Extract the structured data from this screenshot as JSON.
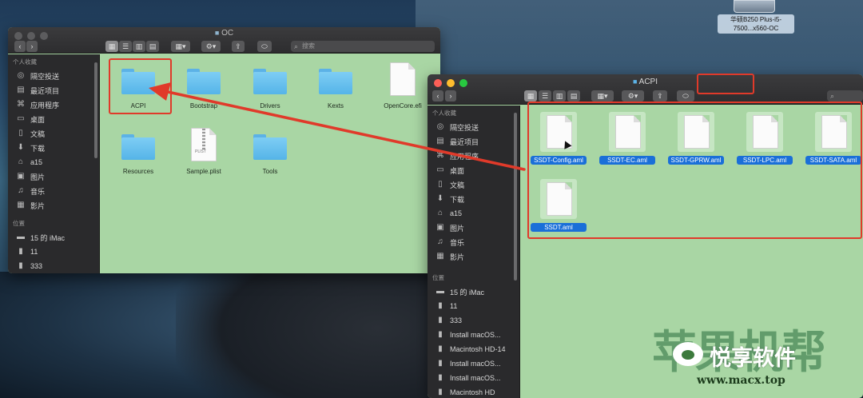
{
  "desktop": {
    "drive_label": "华硕B250 Plus-i5-7500...x560-OC"
  },
  "window_oc": {
    "title": "OC",
    "search_placeholder": "搜索",
    "sidebar": {
      "favorites_heading": "个人收藏",
      "favorites": [
        {
          "label": "隔空投送",
          "icon": "airdrop-icon"
        },
        {
          "label": "最近项目",
          "icon": "recents-icon"
        },
        {
          "label": "应用程序",
          "icon": "applications-icon"
        },
        {
          "label": "桌面",
          "icon": "desktop-icon"
        },
        {
          "label": "文稿",
          "icon": "documents-icon"
        },
        {
          "label": "下载",
          "icon": "downloads-icon"
        },
        {
          "label": "a15",
          "icon": "home-icon"
        },
        {
          "label": "图片",
          "icon": "pictures-icon"
        },
        {
          "label": "音乐",
          "icon": "music-icon"
        },
        {
          "label": "影片",
          "icon": "movies-icon"
        }
      ],
      "locations_heading": "位置",
      "locations": [
        {
          "label": "15 的 iMac",
          "icon": "computer-icon"
        },
        {
          "label": "11",
          "icon": "disk-icon"
        },
        {
          "label": "333",
          "icon": "disk-icon"
        }
      ]
    },
    "items": [
      {
        "label": "ACPI",
        "kind": "folder"
      },
      {
        "label": "Bootstrap",
        "kind": "folder"
      },
      {
        "label": "Drivers",
        "kind": "folder"
      },
      {
        "label": "Kexts",
        "kind": "folder"
      },
      {
        "label": "OpenCore.efi",
        "kind": "document"
      },
      {
        "label": "Resources",
        "kind": "folder"
      },
      {
        "label": "Sample.plist",
        "kind": "plist"
      },
      {
        "label": "Tools",
        "kind": "folder"
      }
    ]
  },
  "window_acpi": {
    "title": "ACPI",
    "sidebar": {
      "favorites_heading": "个人收藏",
      "favorites": [
        {
          "label": "隔空投送",
          "icon": "airdrop-icon"
        },
        {
          "label": "最近项目",
          "icon": "recents-icon"
        },
        {
          "label": "应用程序",
          "icon": "applications-icon"
        },
        {
          "label": "桌面",
          "icon": "desktop-icon"
        },
        {
          "label": "文稿",
          "icon": "documents-icon"
        },
        {
          "label": "下载",
          "icon": "downloads-icon"
        },
        {
          "label": "a15",
          "icon": "home-icon"
        },
        {
          "label": "图片",
          "icon": "pictures-icon"
        },
        {
          "label": "音乐",
          "icon": "music-icon"
        },
        {
          "label": "影片",
          "icon": "movies-icon"
        }
      ],
      "locations_heading": "位置",
      "locations": [
        {
          "label": "15 的 iMac",
          "icon": "computer-icon"
        },
        {
          "label": "11",
          "icon": "disk-icon"
        },
        {
          "label": "333",
          "icon": "disk-icon"
        },
        {
          "label": "Install macOS...",
          "icon": "disk-icon"
        },
        {
          "label": "Macintosh HD-14",
          "icon": "disk-icon"
        },
        {
          "label": "Install macOS...",
          "icon": "disk-icon"
        },
        {
          "label": "Install macOS...",
          "icon": "disk-icon"
        },
        {
          "label": "Macintosh HD",
          "icon": "disk-icon"
        }
      ]
    },
    "files": [
      "SSDT-Config.aml",
      "SSDT-EC.aml",
      "SSDT-GPRW.aml",
      "SSDT-LPC.aml",
      "SSDT-SATA.aml",
      "SSDT.aml"
    ]
  },
  "watermark": {
    "brand": "悦享软件",
    "url": "www.macx.top",
    "big_text": "苹果机帮"
  },
  "colors": {
    "annotation_red": "#e03a2a",
    "selection_blue": "#1a6fd8",
    "finder_bg": "#a9d6a4",
    "folder_blue": "#5cb2e6"
  }
}
